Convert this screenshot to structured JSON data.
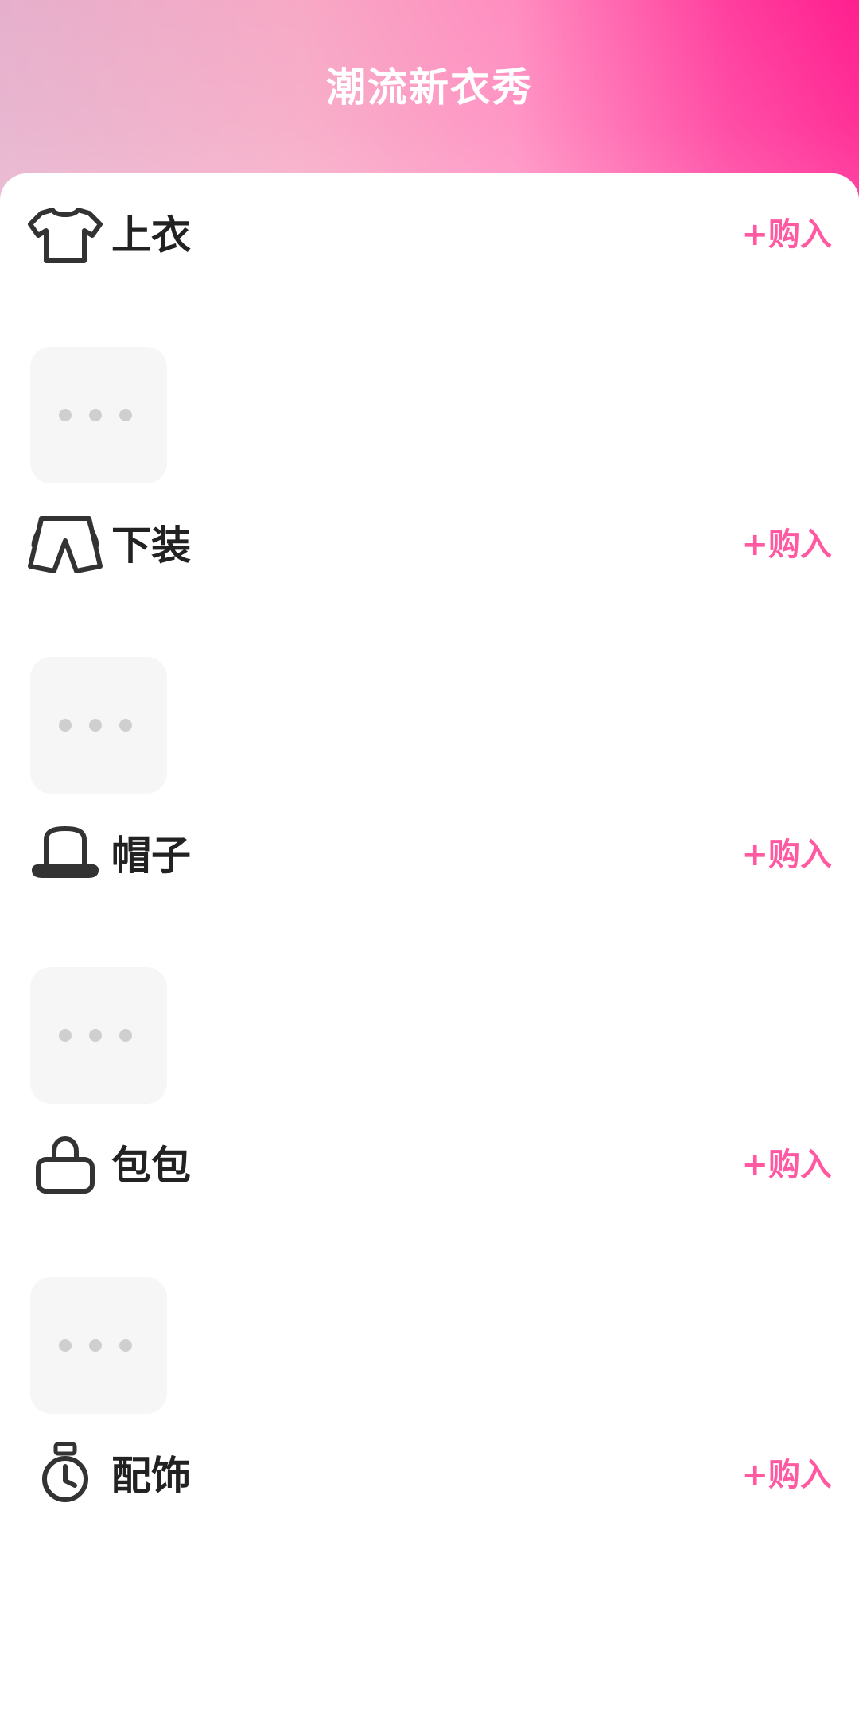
{
  "header": {
    "title": "潮流新衣秀"
  },
  "categories": [
    {
      "label": "上衣",
      "icon": "t-shirt-icon",
      "action_label": "+购入",
      "placeholder_icon": "more-dots-icon"
    },
    {
      "label": "下装",
      "icon": "shorts-icon",
      "action_label": "+购入",
      "placeholder_icon": "more-dots-icon"
    },
    {
      "label": "帽子",
      "icon": "hat-icon",
      "action_label": "+购入",
      "placeholder_icon": "more-dots-icon"
    },
    {
      "label": "包包",
      "icon": "bag-icon",
      "action_label": "+购入",
      "placeholder_icon": "more-dots-icon"
    },
    {
      "label": "配饰",
      "icon": "watch-icon",
      "action_label": "+购入"
    }
  ],
  "colors": {
    "accent_pink": "#ff5aa1",
    "header_gradient_start": "#e6b0cc",
    "header_gradient_end": "#ff1f8f",
    "placeholder_bg": "#f6f6f6",
    "label_text": "#222222"
  }
}
